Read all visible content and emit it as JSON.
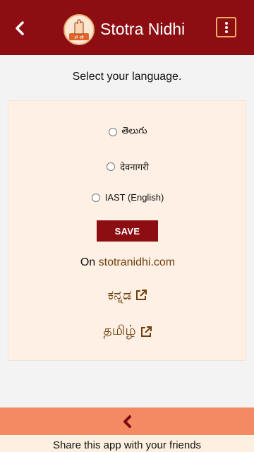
{
  "header": {
    "title": "Stotra Nidhi",
    "logo_text": "ॐ श्री",
    "accent": "#8c0d12"
  },
  "prompt": "Select your language.",
  "languages": [
    {
      "label": "తెలుగు"
    },
    {
      "label": "देवनागरी"
    },
    {
      "label": "IAST (English)"
    }
  ],
  "save_label": "SAVE",
  "site": {
    "prefix": "On",
    "link": "stotranidhi.com"
  },
  "external_links": [
    {
      "label": "ಕನ್ನಡ"
    },
    {
      "label": "தமிழ்"
    }
  ],
  "share_text": "Share this app with your friends"
}
